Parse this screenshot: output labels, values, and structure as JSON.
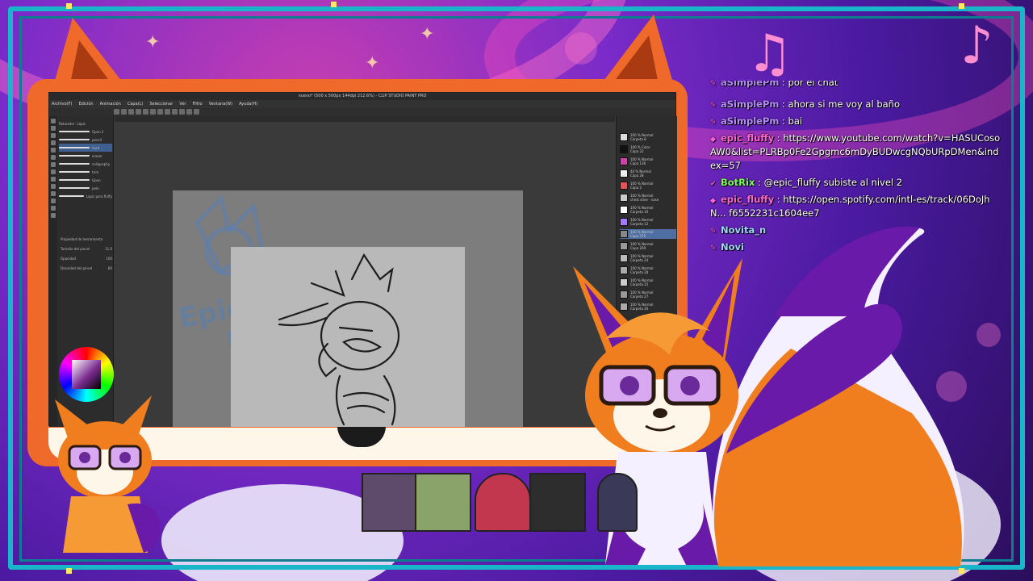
{
  "csp": {
    "title": "nuevo* (500 x 500px 144dpi 212.6%) - CLIP STUDIO PAINT PRO",
    "menu": [
      "Archivo(F)",
      "Edición",
      "Animación",
      "Capa(L)",
      "Seleccionar",
      "Ver",
      "Filtro",
      "Ventana(W)",
      "Ayuda(H)"
    ],
    "brush_tabs": [
      "Rotulador",
      "Lápiz"
    ],
    "brushes": [
      "Gpen 2",
      "pencil",
      "hard",
      "eraser",
      "calligraphy",
      "trim",
      "Gpen",
      "pelo",
      "Lapiz para fluffy"
    ],
    "tool_property_title": "Propiedad de herramienta",
    "tool_properties": [
      {
        "label": "Tamaño del pincel",
        "value": "11.0"
      },
      {
        "label": "Opacidad",
        "value": "100"
      },
      {
        "label": "Densidad del pincel",
        "value": "80"
      }
    ],
    "layers": [
      {
        "name": "100 % Normal",
        "sub": "Carpeta 8"
      },
      {
        "name": "100 % Color",
        "sub": "Capa 22"
      },
      {
        "name": "100 % Normal",
        "sub": "Capa 136"
      },
      {
        "name": "40 % Normal",
        "sub": "Capa 28"
      },
      {
        "name": "100 % Normal",
        "sub": "Capa 2"
      },
      {
        "name": "100 % Normal",
        "sub": "chest stine - vase"
      },
      {
        "name": "100 % Normal",
        "sub": "Carpeta 10"
      },
      {
        "name": "100 % Normal",
        "sub": "Carpeta 12"
      },
      {
        "name": "100 % Normal",
        "sub": "Capa 270"
      },
      {
        "name": "100 % Normal",
        "sub": "Capa 269"
      },
      {
        "name": "100 % Normal",
        "sub": "Carpeta 24"
      },
      {
        "name": "100 % Normal",
        "sub": "Carpeta 28"
      },
      {
        "name": "100 % Normal",
        "sub": "Carpeta 25"
      },
      {
        "name": "100 % Normal",
        "sub": "Carpeta 27"
      },
      {
        "name": "100 % Normal",
        "sub": "Carpeta 26"
      }
    ],
    "watermark": "Epic Fluffy"
  },
  "chat": {
    "messages": [
      {
        "user": "aSimplePm",
        "color": "#b58cff",
        "text": ": por el chat"
      },
      {
        "user": "aSimplePm",
        "color": "#b58cff",
        "text": ": ahora si me voy al baño"
      },
      {
        "user": "aSimplePm",
        "color": "#b58cff",
        "text": ": bai"
      },
      {
        "user": "epic_fluffy",
        "color": "#ff66d4",
        "text": ": https://www.youtube.com/watch?v=HASUCosoAW0&list=PLRBp0Fe2Gpgmc6mDyBUDwcgNQbURpDMen&index=57"
      },
      {
        "user": "BotRix",
        "color": "#7cff5a",
        "text": ": @epic_fluffy subiste al nivel 2"
      },
      {
        "user": "epic_fluffy",
        "color": "#ff66d4",
        "text": ": https://open.spotify.com/intl-es/track/06DoJhN... f6552231c1604ee7"
      },
      {
        "user": "Novita_n",
        "color": "#9fd6ff",
        "text": ""
      },
      {
        "user": "Novi",
        "color": "#9fd6ff",
        "text": ""
      }
    ]
  },
  "colors": {
    "frame": "#19b6c9",
    "bezel": "#ef6a2a",
    "fox_orange": "#f07d1e",
    "fox_purple": "#6a1aa8"
  }
}
